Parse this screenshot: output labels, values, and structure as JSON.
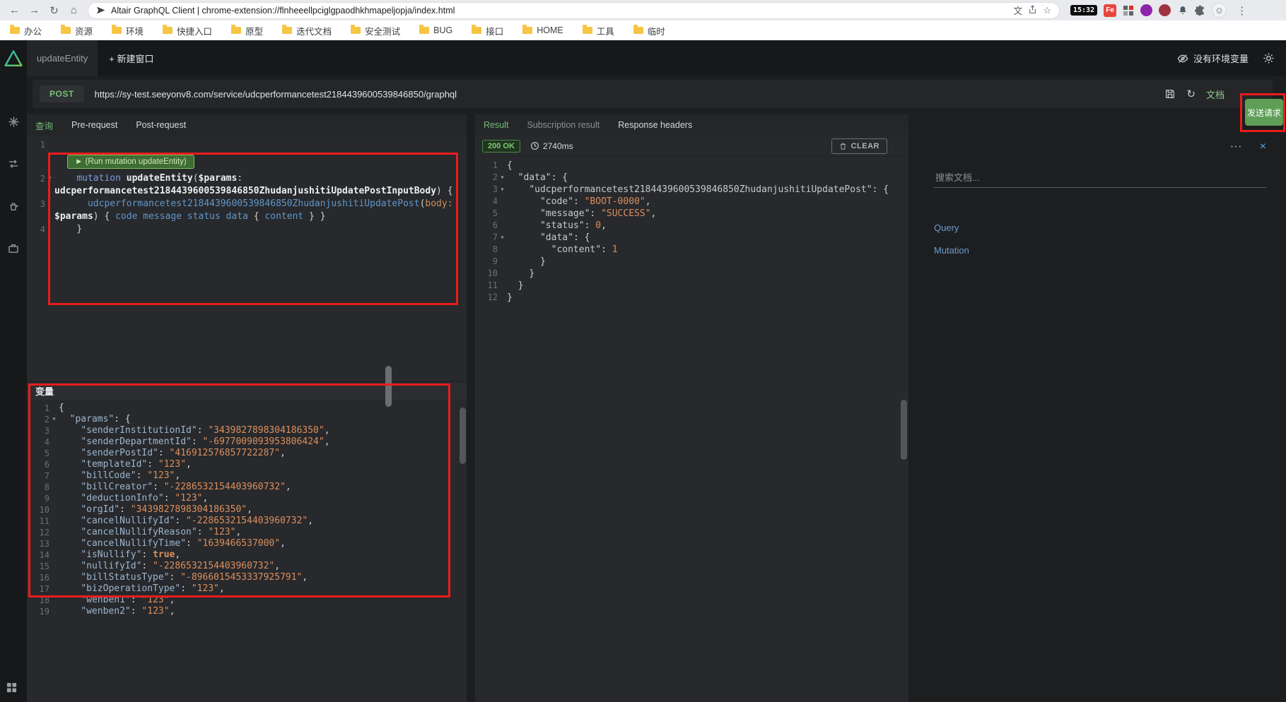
{
  "icons": {
    "back": "←",
    "forward": "→",
    "reload": "↻",
    "home": "⌂",
    "translate": "文",
    "star": "☆",
    "menu": "⋮",
    "more": "⋯",
    "close": "×",
    "fold": "▾",
    "refresh": "↻",
    "avatar": "☺"
  },
  "browser": {
    "address": "Altair GraphQL Client | chrome-extension://flnheeellpciglgpaodhkhmapeljopja/index.html",
    "time_badge": "15:32",
    "fe_badge": "Fe",
    "bookmarks": [
      "办公",
      "资源",
      "环境",
      "快捷入口",
      "原型",
      "迭代文档",
      "安全测试",
      "BUG",
      "接口",
      "HOME",
      "工具",
      "临时"
    ]
  },
  "app_header": {
    "tab": "updateEntity",
    "new_window": "+ 新建窗口",
    "no_env": "没有环境变量"
  },
  "request": {
    "method": "POST",
    "url": "https://sy-test.seeyonv8.com/service/udcperformancetest2184439600539846850/graphql",
    "docs": "文档",
    "send": "发送请求"
  },
  "query_panel": {
    "tabs": [
      {
        "label": "查询",
        "active": true
      },
      {
        "label": "Pre-request"
      },
      {
        "label": "Post-request"
      }
    ],
    "run_button": "► (Run mutation updateEntity)",
    "code": [
      {
        "n": "1",
        "tokens": []
      },
      {
        "w": "query_panel.run_button"
      },
      {
        "n": "2",
        "fold": true,
        "tokens": [
          [
            "ind",
            "    "
          ],
          [
            "kw",
            "mutation "
          ],
          [
            "bold",
            "updateEntity"
          ],
          [
            "p",
            "("
          ],
          [
            "bold",
            "$params"
          ],
          [
            "p",
            ":"
          ]
        ]
      },
      {
        "tokens": [
          [
            "bold",
            "udcperformancetest2184439600539846850ZhudanjushitiUpdatePostInputBody"
          ],
          [
            "p",
            ") {"
          ]
        ]
      },
      {
        "n": "3",
        "tokens": [
          [
            "ind",
            "      "
          ],
          [
            "field",
            "udcperformancetest2184439600539846850ZhudanjushitiUpdatePost"
          ],
          [
            "p",
            "("
          ],
          [
            "attr",
            "body:"
          ]
        ]
      },
      {
        "tokens": [
          [
            "bold",
            "$params"
          ],
          [
            "p",
            ") { "
          ],
          [
            "field",
            "code message status data "
          ],
          [
            "p",
            "{ "
          ],
          [
            "field",
            "content"
          ],
          [
            "p",
            " } }"
          ]
        ]
      },
      {
        "n": "4",
        "tokens": [
          [
            "ind",
            "    "
          ],
          [
            "p",
            "}"
          ]
        ]
      }
    ],
    "variables_title": "变量",
    "variables_code": [
      {
        "n": "1",
        "tokens": [
          [
            "p",
            "{"
          ]
        ]
      },
      {
        "n": "2",
        "fold": true,
        "tokens": [
          [
            "ind",
            "  "
          ],
          [
            "vkey",
            "\"params\""
          ],
          [
            "p",
            ": {"
          ]
        ]
      },
      {
        "n": "3",
        "tokens": [
          [
            "ind",
            "    "
          ],
          [
            "vkey",
            "\"senderInstitutionId\""
          ],
          [
            "p",
            ": "
          ],
          [
            "str",
            "\"3439827898304186350\""
          ],
          [
            "p",
            ","
          ]
        ]
      },
      {
        "n": "4",
        "tokens": [
          [
            "ind",
            "    "
          ],
          [
            "vkey",
            "\"senderDepartmentId\""
          ],
          [
            "p",
            ": "
          ],
          [
            "str",
            "\"-6977009093953806424\""
          ],
          [
            "p",
            ","
          ]
        ]
      },
      {
        "n": "5",
        "tokens": [
          [
            "ind",
            "    "
          ],
          [
            "vkey",
            "\"senderPostId\""
          ],
          [
            "p",
            ": "
          ],
          [
            "str",
            "\"416912576857722287\""
          ],
          [
            "p",
            ","
          ]
        ]
      },
      {
        "n": "6",
        "tokens": [
          [
            "ind",
            "    "
          ],
          [
            "vkey",
            "\"templateId\""
          ],
          [
            "p",
            ": "
          ],
          [
            "str",
            "\"123\""
          ],
          [
            "p",
            ","
          ]
        ]
      },
      {
        "n": "7",
        "tokens": [
          [
            "ind",
            "    "
          ],
          [
            "vkey",
            "\"billCode\""
          ],
          [
            "p",
            ": "
          ],
          [
            "str",
            "\"123\""
          ],
          [
            "p",
            ","
          ]
        ]
      },
      {
        "n": "8",
        "tokens": [
          [
            "ind",
            "    "
          ],
          [
            "vkey",
            "\"billCreator\""
          ],
          [
            "p",
            ": "
          ],
          [
            "str",
            "\"-2286532154403960732\""
          ],
          [
            "p",
            ","
          ]
        ]
      },
      {
        "n": "9",
        "tokens": [
          [
            "ind",
            "    "
          ],
          [
            "vkey",
            "\"deductionInfo\""
          ],
          [
            "p",
            ": "
          ],
          [
            "str",
            "\"123\""
          ],
          [
            "p",
            ","
          ]
        ]
      },
      {
        "n": "10",
        "tokens": [
          [
            "ind",
            "    "
          ],
          [
            "vkey",
            "\"orgId\""
          ],
          [
            "p",
            ": "
          ],
          [
            "str",
            "\"3439827898304186350\""
          ],
          [
            "p",
            ","
          ]
        ]
      },
      {
        "n": "11",
        "tokens": [
          [
            "ind",
            "    "
          ],
          [
            "vkey",
            "\"cancelNullifyId\""
          ],
          [
            "p",
            ": "
          ],
          [
            "str",
            "\"-2286532154403960732\""
          ],
          [
            "p",
            ","
          ]
        ]
      },
      {
        "n": "12",
        "tokens": [
          [
            "ind",
            "    "
          ],
          [
            "vkey",
            "\"cancelNullifyReason\""
          ],
          [
            "p",
            ": "
          ],
          [
            "str",
            "\"123\""
          ],
          [
            "p",
            ","
          ]
        ]
      },
      {
        "n": "13",
        "tokens": [
          [
            "ind",
            "    "
          ],
          [
            "vkey",
            "\"cancelNullifyTime\""
          ],
          [
            "p",
            ": "
          ],
          [
            "str",
            "\"1639466537000\""
          ],
          [
            "p",
            ","
          ]
        ]
      },
      {
        "n": "14",
        "tokens": [
          [
            "ind",
            "    "
          ],
          [
            "vkey",
            "\"isNullify\""
          ],
          [
            "p",
            ": "
          ],
          [
            "bool",
            "true"
          ],
          [
            "p",
            ","
          ]
        ]
      },
      {
        "n": "15",
        "tokens": [
          [
            "ind",
            "    "
          ],
          [
            "vkey",
            "\"nullifyId\""
          ],
          [
            "p",
            ": "
          ],
          [
            "str",
            "\"-2286532154403960732\""
          ],
          [
            "p",
            ","
          ]
        ]
      },
      {
        "n": "16",
        "tokens": [
          [
            "ind",
            "    "
          ],
          [
            "vkey",
            "\"billStatusType\""
          ],
          [
            "p",
            ": "
          ],
          [
            "str",
            "\"-8966015453337925791\""
          ],
          [
            "p",
            ","
          ]
        ]
      },
      {
        "n": "17",
        "tokens": [
          [
            "ind",
            "    "
          ],
          [
            "vkey",
            "\"bizOperationType\""
          ],
          [
            "p",
            ": "
          ],
          [
            "str",
            "\"123\""
          ],
          [
            "p",
            ","
          ]
        ]
      },
      {
        "n": "18",
        "tokens": [
          [
            "ind",
            "    "
          ],
          [
            "vkey",
            "\"wenben1\""
          ],
          [
            "p",
            ": "
          ],
          [
            "str",
            "\"123\""
          ],
          [
            "p",
            ","
          ]
        ]
      },
      {
        "n": "19",
        "tokens": [
          [
            "ind",
            "    "
          ],
          [
            "vkey",
            "\"wenben2\""
          ],
          [
            "p",
            ": "
          ],
          [
            "str",
            "\"123\""
          ],
          [
            "p",
            ","
          ]
        ]
      }
    ]
  },
  "result_panel": {
    "tabs": [
      {
        "label": "Result",
        "active": true
      },
      {
        "label": "Subscription result",
        "muted": true
      },
      {
        "label": "Response headers"
      }
    ],
    "status": "200 OK",
    "duration": "2740ms",
    "clear": "CLEAR",
    "code": [
      {
        "n": "1",
        "tokens": [
          [
            "p",
            "{"
          ]
        ]
      },
      {
        "n": "2",
        "fold": true,
        "tokens": [
          [
            "ind",
            "  "
          ],
          [
            "key",
            "\"data\""
          ],
          [
            "p",
            ": {"
          ]
        ]
      },
      {
        "n": "3",
        "fold": true,
        "tokens": [
          [
            "ind",
            "    "
          ],
          [
            "key",
            "\"udcperformancetest2184439600539846850ZhudanjushitiUpdatePost\""
          ],
          [
            "p",
            ": {"
          ]
        ]
      },
      {
        "n": "4",
        "tokens": [
          [
            "ind",
            "      "
          ],
          [
            "key",
            "\"code\""
          ],
          [
            "p",
            ": "
          ],
          [
            "str",
            "\"BOOT-0000\""
          ],
          [
            "p",
            ","
          ]
        ]
      },
      {
        "n": "5",
        "tokens": [
          [
            "ind",
            "      "
          ],
          [
            "key",
            "\"message\""
          ],
          [
            "p",
            ": "
          ],
          [
            "str",
            "\"SUCCESS\""
          ],
          [
            "p",
            ","
          ]
        ]
      },
      {
        "n": "6",
        "tokens": [
          [
            "ind",
            "      "
          ],
          [
            "key",
            "\"status\""
          ],
          [
            "p",
            ": "
          ],
          [
            "num",
            "0"
          ],
          [
            "p",
            ","
          ]
        ]
      },
      {
        "n": "7",
        "fold": true,
        "tokens": [
          [
            "ind",
            "      "
          ],
          [
            "key",
            "\"data\""
          ],
          [
            "p",
            ": {"
          ]
        ]
      },
      {
        "n": "8",
        "tokens": [
          [
            "ind",
            "        "
          ],
          [
            "key",
            "\"content\""
          ],
          [
            "p",
            ": "
          ],
          [
            "num",
            "1"
          ]
        ]
      },
      {
        "n": "9",
        "tokens": [
          [
            "ind",
            "      "
          ],
          [
            "p",
            "}"
          ]
        ]
      },
      {
        "n": "10",
        "tokens": [
          [
            "ind",
            "    "
          ],
          [
            "p",
            "}"
          ]
        ]
      },
      {
        "n": "11",
        "tokens": [
          [
            "ind",
            "  "
          ],
          [
            "p",
            "}"
          ]
        ]
      },
      {
        "n": "12",
        "tokens": [
          [
            "p",
            "}"
          ]
        ]
      }
    ]
  },
  "docs_panel": {
    "search_placeholder": "搜索文档...",
    "items": [
      "Query",
      "Mutation"
    ]
  }
}
